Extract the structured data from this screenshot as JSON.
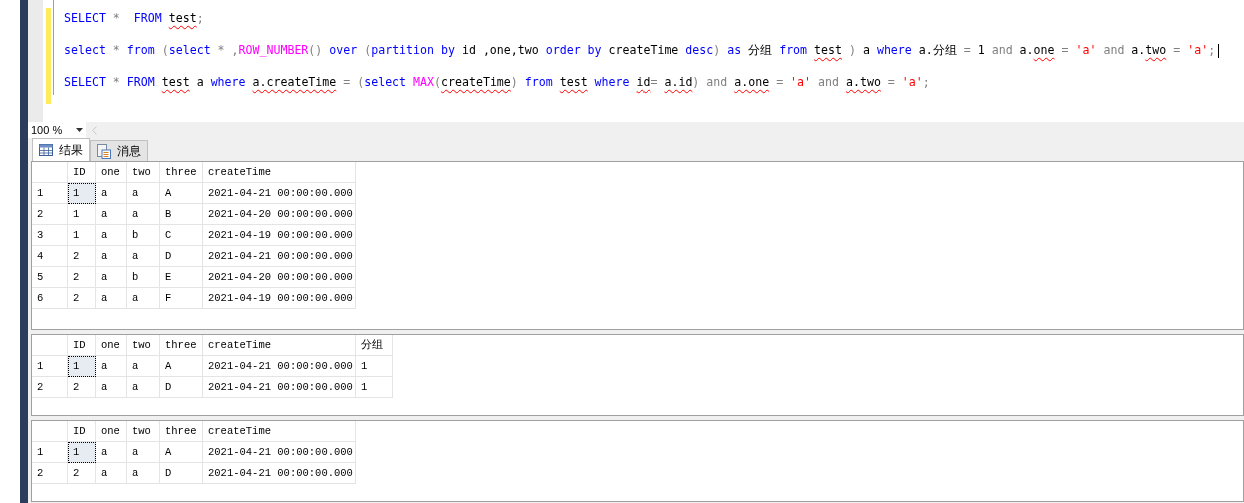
{
  "editor": {
    "lines": [
      {
        "changed": true,
        "tokens": [
          {
            "text": "SELECT",
            "kind": "keyword"
          },
          {
            "text": " * ",
            "kind": "operator"
          },
          {
            "text": " FROM ",
            "kind": "keyword"
          },
          {
            "text": "test",
            "kind": "plain",
            "squiggle": true
          },
          {
            "text": ";",
            "kind": "operator"
          }
        ]
      },
      {
        "changed": true,
        "tokens": [
          {
            "text": "select",
            "kind": "keyword"
          },
          {
            "text": " * ",
            "kind": "operator"
          },
          {
            "text": "from",
            "kind": "keyword"
          },
          {
            "text": " (",
            "kind": "operator"
          },
          {
            "text": "select",
            "kind": "keyword"
          },
          {
            "text": " * ,",
            "kind": "operator"
          },
          {
            "text": "ROW_NUMBER",
            "kind": "function"
          },
          {
            "text": "() ",
            "kind": "operator"
          },
          {
            "text": "over",
            "kind": "keyword"
          },
          {
            "text": " (",
            "kind": "operator"
          },
          {
            "text": "partition by",
            "kind": "keyword"
          },
          {
            "text": " id ,one,two ",
            "kind": "plain"
          },
          {
            "text": "order by",
            "kind": "keyword"
          },
          {
            "text": " createTime ",
            "kind": "plain"
          },
          {
            "text": "desc",
            "kind": "keyword"
          },
          {
            "text": ") ",
            "kind": "operator"
          },
          {
            "text": "as",
            "kind": "keyword"
          },
          {
            "text": " 分组 ",
            "kind": "plain"
          },
          {
            "text": "from ",
            "kind": "keyword"
          },
          {
            "text": "test",
            "kind": "plain",
            "squiggle": true
          },
          {
            "text": " ) ",
            "kind": "operator"
          },
          {
            "text": "a ",
            "kind": "plain"
          },
          {
            "text": "where",
            "kind": "keyword"
          },
          {
            "text": " a.分组 ",
            "kind": "plain"
          },
          {
            "text": "= ",
            "kind": "operator"
          },
          {
            "text": "1 ",
            "kind": "plain"
          },
          {
            "text": "and",
            "kind": "operator"
          },
          {
            "text": " a.",
            "kind": "plain"
          },
          {
            "text": "one",
            "kind": "plain",
            "squiggle": true
          },
          {
            "text": " = ",
            "kind": "operator"
          },
          {
            "text": "'a'",
            "kind": "string"
          },
          {
            "text": " and",
            "kind": "operator"
          },
          {
            "text": " a.",
            "kind": "plain"
          },
          {
            "text": "two",
            "kind": "plain",
            "squiggle": true
          },
          {
            "text": " = ",
            "kind": "operator"
          },
          {
            "text": "'a'",
            "kind": "string"
          },
          {
            "text": ";",
            "kind": "operator"
          }
        ],
        "caret": true
      },
      {
        "changed": true,
        "tokens": [
          {
            "text": "SELECT",
            "kind": "keyword"
          },
          {
            "text": " * ",
            "kind": "operator"
          },
          {
            "text": "FROM ",
            "kind": "keyword"
          },
          {
            "text": "test",
            "kind": "plain",
            "squiggle": true
          },
          {
            "text": " a ",
            "kind": "plain"
          },
          {
            "text": "where ",
            "kind": "keyword"
          },
          {
            "text": "a.createTime",
            "kind": "plain",
            "squiggle": true
          },
          {
            "text": " = (",
            "kind": "operator"
          },
          {
            "text": "select ",
            "kind": "keyword"
          },
          {
            "text": "MAX",
            "kind": "function"
          },
          {
            "text": "(",
            "kind": "operator"
          },
          {
            "text": "createTime",
            "kind": "plain",
            "squiggle": true
          },
          {
            "text": ") ",
            "kind": "operator"
          },
          {
            "text": "from ",
            "kind": "keyword"
          },
          {
            "text": "test",
            "kind": "plain",
            "squiggle": true
          },
          {
            "text": " where ",
            "kind": "keyword"
          },
          {
            "text": "id",
            "kind": "plain",
            "squiggle": true
          },
          {
            "text": "= ",
            "kind": "operator"
          },
          {
            "text": "a.id",
            "kind": "plain",
            "squiggle": true
          },
          {
            "text": ") and ",
            "kind": "operator"
          },
          {
            "text": "a.one",
            "kind": "plain",
            "squiggle": true
          },
          {
            "text": " = ",
            "kind": "operator"
          },
          {
            "text": "'a'",
            "kind": "string"
          },
          {
            "text": " and ",
            "kind": "operator"
          },
          {
            "text": "a.two",
            "kind": "plain",
            "squiggle": true
          },
          {
            "text": " = ",
            "kind": "operator"
          },
          {
            "text": "'a'",
            "kind": "string"
          },
          {
            "text": ";",
            "kind": "operator"
          }
        ]
      }
    ]
  },
  "zoom": {
    "value": "100 %"
  },
  "tabs": [
    {
      "label": "结果",
      "selected": true
    },
    {
      "label": "消息",
      "selected": false
    }
  ],
  "grids": [
    {
      "columns": [
        "ID",
        "one",
        "two",
        "three",
        "createTime"
      ],
      "rows": [
        {
          "number": "1",
          "selected": true,
          "cells": [
            "1",
            "a",
            "a",
            "A",
            "2021-04-21 00:00:00.000"
          ]
        },
        {
          "number": "2",
          "selected": false,
          "cells": [
            "1",
            "a",
            "a",
            "B",
            "2021-04-20 00:00:00.000"
          ]
        },
        {
          "number": "3",
          "selected": false,
          "cells": [
            "1",
            "a",
            "b",
            "C",
            "2021-04-19 00:00:00.000"
          ]
        },
        {
          "number": "4",
          "selected": false,
          "cells": [
            "2",
            "a",
            "a",
            "D",
            "2021-04-21 00:00:00.000"
          ]
        },
        {
          "number": "5",
          "selected": false,
          "cells": [
            "2",
            "a",
            "b",
            "E",
            "2021-04-20 00:00:00.000"
          ]
        },
        {
          "number": "6",
          "selected": false,
          "cells": [
            "2",
            "a",
            "a",
            "F",
            "2021-04-19 00:00:00.000"
          ]
        }
      ]
    },
    {
      "columns": [
        "ID",
        "one",
        "two",
        "three",
        "createTime",
        "分组"
      ],
      "rows": [
        {
          "number": "1",
          "selected": true,
          "cells": [
            "1",
            "a",
            "a",
            "A",
            "2021-04-21 00:00:00.000",
            "1"
          ]
        },
        {
          "number": "2",
          "selected": false,
          "cells": [
            "2",
            "a",
            "a",
            "D",
            "2021-04-21 00:00:00.000",
            "1"
          ]
        }
      ]
    },
    {
      "columns": [
        "ID",
        "one",
        "two",
        "three",
        "createTime"
      ],
      "rows": [
        {
          "number": "1",
          "selected": true,
          "cells": [
            "1",
            "a",
            "a",
            "A",
            "2021-04-21 00:00:00.000"
          ]
        },
        {
          "number": "2",
          "selected": false,
          "cells": [
            "2",
            "a",
            "a",
            "D",
            "2021-04-21 00:00:00.000"
          ]
        }
      ]
    }
  ]
}
